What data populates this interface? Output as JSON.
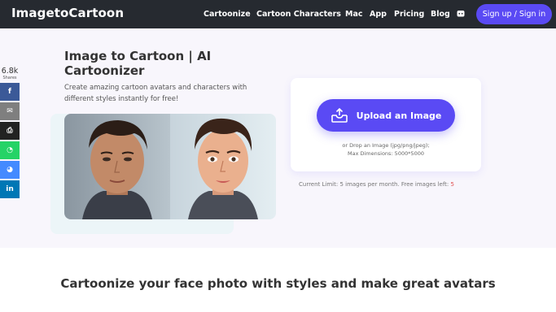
{
  "header": {
    "logo": "ImagetoCartoon",
    "nav": [
      "Cartoonize",
      "Cartoon Characters",
      "Mac",
      "App",
      "Pricing",
      "Blog"
    ],
    "discord_icon": "discord-icon",
    "signup": "Sign up / Sign in"
  },
  "share": {
    "count": "6.8k",
    "label": "Shares",
    "buttons": [
      {
        "icon": "facebook-icon",
        "glyph": "f"
      },
      {
        "icon": "email-icon",
        "glyph": "✉"
      },
      {
        "icon": "print-icon",
        "glyph": "⎙"
      },
      {
        "icon": "whatsapp-icon",
        "glyph": "◔"
      },
      {
        "icon": "messenger-icon",
        "glyph": "◕"
      },
      {
        "icon": "linkedin-icon",
        "glyph": "in"
      }
    ]
  },
  "hero": {
    "title": "Image to Cartoon | AI Cartoonizer",
    "subtitle": "Create amazing cartoon avatars and characters with different styles instantly for free!"
  },
  "upload": {
    "button": "Upload an Image",
    "drop_line1": "or Drop an Image (jpg/png/jpeg);",
    "drop_line2": "Max Dimensions: 5000*5000",
    "limit_text": "Current Limit: 5 images per month. Free images left:",
    "limit_left": "5"
  },
  "bottom": {
    "heading": "Cartoonize your face photo with styles and make great avatars"
  },
  "colors": {
    "header_bg": "#262a30",
    "accent": "#5a4af4",
    "page_bg": "#f8f6fc"
  }
}
